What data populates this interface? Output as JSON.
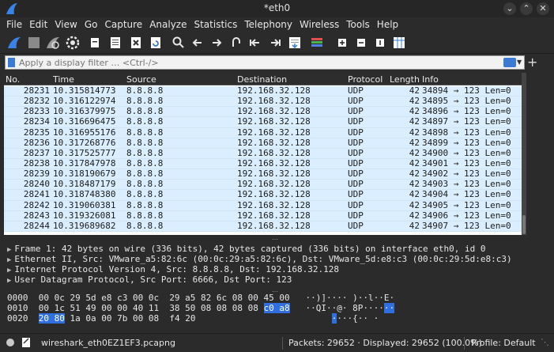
{
  "window": {
    "title": "*eth0"
  },
  "menu": [
    "File",
    "Edit",
    "View",
    "Go",
    "Capture",
    "Analyze",
    "Statistics",
    "Telephony",
    "Wireless",
    "Tools",
    "Help"
  ],
  "filter": {
    "placeholder": "Apply a display filter … <Ctrl-/>"
  },
  "packet_list": {
    "columns": [
      "No.",
      "Time",
      "Source",
      "Destination",
      "Protocol",
      "Length",
      "Info"
    ],
    "rows": [
      {
        "no": "28231",
        "time": "10.315814773",
        "src": "8.8.8.8",
        "dst": "192.168.32.128",
        "proto": "UDP",
        "len": "42",
        "info": "34894 → 123 Len=0"
      },
      {
        "no": "28232",
        "time": "10.316122974",
        "src": "8.8.8.8",
        "dst": "192.168.32.128",
        "proto": "UDP",
        "len": "42",
        "info": "34895 → 123 Len=0"
      },
      {
        "no": "28233",
        "time": "10.316379975",
        "src": "8.8.8.8",
        "dst": "192.168.32.128",
        "proto": "UDP",
        "len": "42",
        "info": "34896 → 123 Len=0"
      },
      {
        "no": "28234",
        "time": "10.316696475",
        "src": "8.8.8.8",
        "dst": "192.168.32.128",
        "proto": "UDP",
        "len": "42",
        "info": "34897 → 123 Len=0"
      },
      {
        "no": "28235",
        "time": "10.316955176",
        "src": "8.8.8.8",
        "dst": "192.168.32.128",
        "proto": "UDP",
        "len": "42",
        "info": "34898 → 123 Len=0"
      },
      {
        "no": "28236",
        "time": "10.317268776",
        "src": "8.8.8.8",
        "dst": "192.168.32.128",
        "proto": "UDP",
        "len": "42",
        "info": "34899 → 123 Len=0"
      },
      {
        "no": "28237",
        "time": "10.317525777",
        "src": "8.8.8.8",
        "dst": "192.168.32.128",
        "proto": "UDP",
        "len": "42",
        "info": "34900 → 123 Len=0"
      },
      {
        "no": "28238",
        "time": "10.317847978",
        "src": "8.8.8.8",
        "dst": "192.168.32.128",
        "proto": "UDP",
        "len": "42",
        "info": "34901 → 123 Len=0"
      },
      {
        "no": "28239",
        "time": "10.318190679",
        "src": "8.8.8.8",
        "dst": "192.168.32.128",
        "proto": "UDP",
        "len": "42",
        "info": "34902 → 123 Len=0"
      },
      {
        "no": "28240",
        "time": "10.318487179",
        "src": "8.8.8.8",
        "dst": "192.168.32.128",
        "proto": "UDP",
        "len": "42",
        "info": "34903 → 123 Len=0"
      },
      {
        "no": "28241",
        "time": "10.318748380",
        "src": "8.8.8.8",
        "dst": "192.168.32.128",
        "proto": "UDP",
        "len": "42",
        "info": "34904 → 123 Len=0"
      },
      {
        "no": "28242",
        "time": "10.319060381",
        "src": "8.8.8.8",
        "dst": "192.168.32.128",
        "proto": "UDP",
        "len": "42",
        "info": "34905 → 123 Len=0"
      },
      {
        "no": "28243",
        "time": "10.319326081",
        "src": "8.8.8.8",
        "dst": "192.168.32.128",
        "proto": "UDP",
        "len": "42",
        "info": "34906 → 123 Len=0"
      },
      {
        "no": "28244",
        "time": "10.319689682",
        "src": "8.8.8.8",
        "dst": "192.168.32.128",
        "proto": "UDP",
        "len": "42",
        "info": "34907 → 123 Len=0"
      }
    ]
  },
  "details": [
    "Frame 1: 42 bytes on wire (336 bits), 42 bytes captured (336 bits) on interface eth0, id 0",
    "Ethernet II, Src: VMware_a5:82:6c (00:0c:29:a5:82:6c), Dst: VMware_5d:e8:c3 (00:0c:29:5d:e8:c3)",
    "Internet Protocol Version 4, Src: 8.8.8.8, Dst: 192.168.32.128",
    "User Datagram Protocol, Src Port: 6666, Dst Port: 123"
  ],
  "bytes": [
    {
      "offset": "0000",
      "hex": "00 0c 29 5d e8 c3 00 0c  29 a5 82 6c 08 00 45 00",
      "hex_hl": "",
      "ascii": "··)]···· )··l··E·",
      "ascii_hl": ""
    },
    {
      "offset": "0010",
      "hex": "00 1c 51 49 00 00 40 11  38 50 08 08 08 08 ",
      "hex_hl": "c0 a8",
      "ascii": "··QI··@· 8P····",
      "ascii_hl": "··"
    },
    {
      "offset": "0020",
      "hex_pre": "20 80",
      "hex": " 1a 0a 00 7b 00 08  f4 20",
      "ascii_pre": "·",
      "ascii": "···{·· ·"
    }
  ],
  "status": {
    "file": "wireshark_eth0EZ1EF3.pcapng",
    "packets": "Packets: 29652 · Displayed: 29652 (100.0%)",
    "profile": "Profile: Default"
  },
  "colors": {
    "row_bg": "#dbeeff",
    "highlight": "#2f6fe0",
    "accent": "#3b7bd6"
  }
}
